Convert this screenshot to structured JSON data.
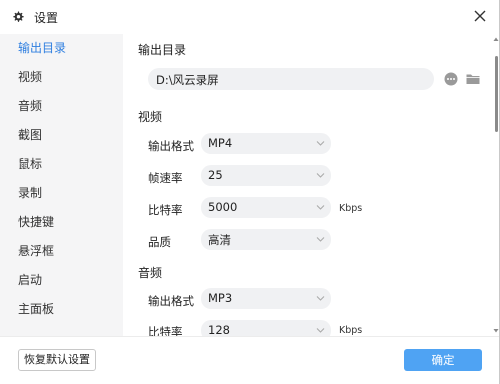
{
  "window": {
    "title": "设置"
  },
  "sidebar": {
    "items": [
      {
        "label": "输出目录",
        "active": true
      },
      {
        "label": "视频"
      },
      {
        "label": "音频"
      },
      {
        "label": "截图"
      },
      {
        "label": "鼠标"
      },
      {
        "label": "录制"
      },
      {
        "label": "快捷键"
      },
      {
        "label": "悬浮框"
      },
      {
        "label": "启动"
      },
      {
        "label": "主面板"
      }
    ]
  },
  "output": {
    "section_title": "输出目录",
    "path": "D:\\风云录屏"
  },
  "video": {
    "section_title": "视频",
    "format_label": "输出格式",
    "format_value": "MP4",
    "fps_label": "帧速率",
    "fps_value": "25",
    "bitrate_label": "比特率",
    "bitrate_value": "5000",
    "bitrate_unit": "Kbps",
    "quality_label": "品质",
    "quality_value": "高清"
  },
  "audio": {
    "section_title": "音频",
    "format_label": "输出格式",
    "format_value": "MP3",
    "bitrate_label": "比特率",
    "bitrate_value": "128",
    "bitrate_unit": "Kbps"
  },
  "footer": {
    "reset_label": "恢复默认设置",
    "ok_label": "确定"
  },
  "colors": {
    "accent": "#2f7fe0",
    "ok_button": "#4fa3f3",
    "field_bg": "#f0f1f3",
    "sidebar_bg": "#f5f5f6"
  },
  "icons": [
    "gear-icon",
    "close-icon",
    "more-icon",
    "folder-icon",
    "chevron-down-icon"
  ]
}
